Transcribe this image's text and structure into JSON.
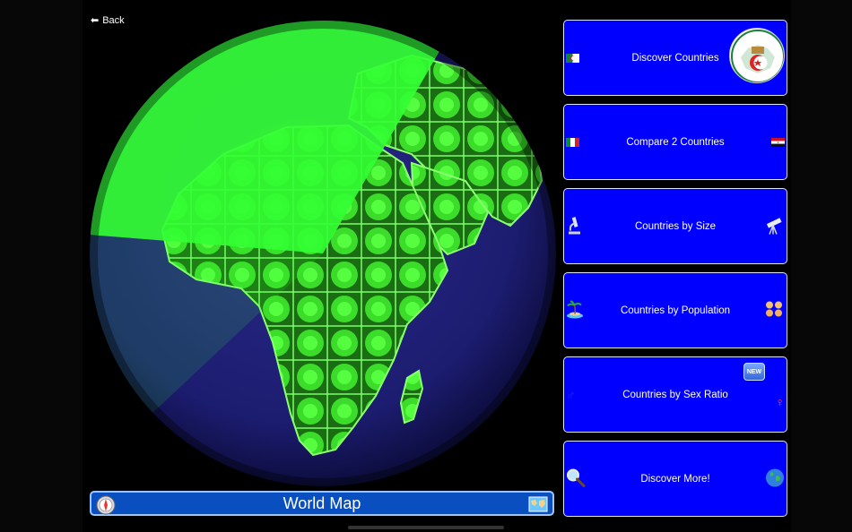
{
  "nav": {
    "back_label": "Back"
  },
  "map_bar": {
    "label": "World Map",
    "left_icon": "compass-icon",
    "right_icon": "map-icon"
  },
  "menu": [
    {
      "label": "Discover Countries",
      "left_icon": "algeria-flag-icon",
      "right_icon": "algeria-emblem-icon"
    },
    {
      "label": "Compare 2 Countries",
      "left_icon": "italy-flag-icon",
      "right_icon": "egypt-flag-icon"
    },
    {
      "label": "Countries by Size",
      "left_icon": "microscope-icon",
      "right_icon": "telescope-icon"
    },
    {
      "label": "Countries by Population",
      "left_icon": "island-icon",
      "right_icon": "people-icon"
    },
    {
      "label": "Countries by Sex Ratio",
      "left_icon": "male-symbol-icon",
      "right_icon": "female-symbol-icon",
      "badge": "NEW"
    },
    {
      "label": "Discover More!",
      "left_icon": "magnifier-icon",
      "right_icon": "earth-globe-icon"
    }
  ],
  "colors": {
    "button_bg": "#0000ff",
    "map_bar_bg": "#0a4fbf",
    "land_green": "#33ff33",
    "ocean_navy": "#1b1b6e"
  }
}
